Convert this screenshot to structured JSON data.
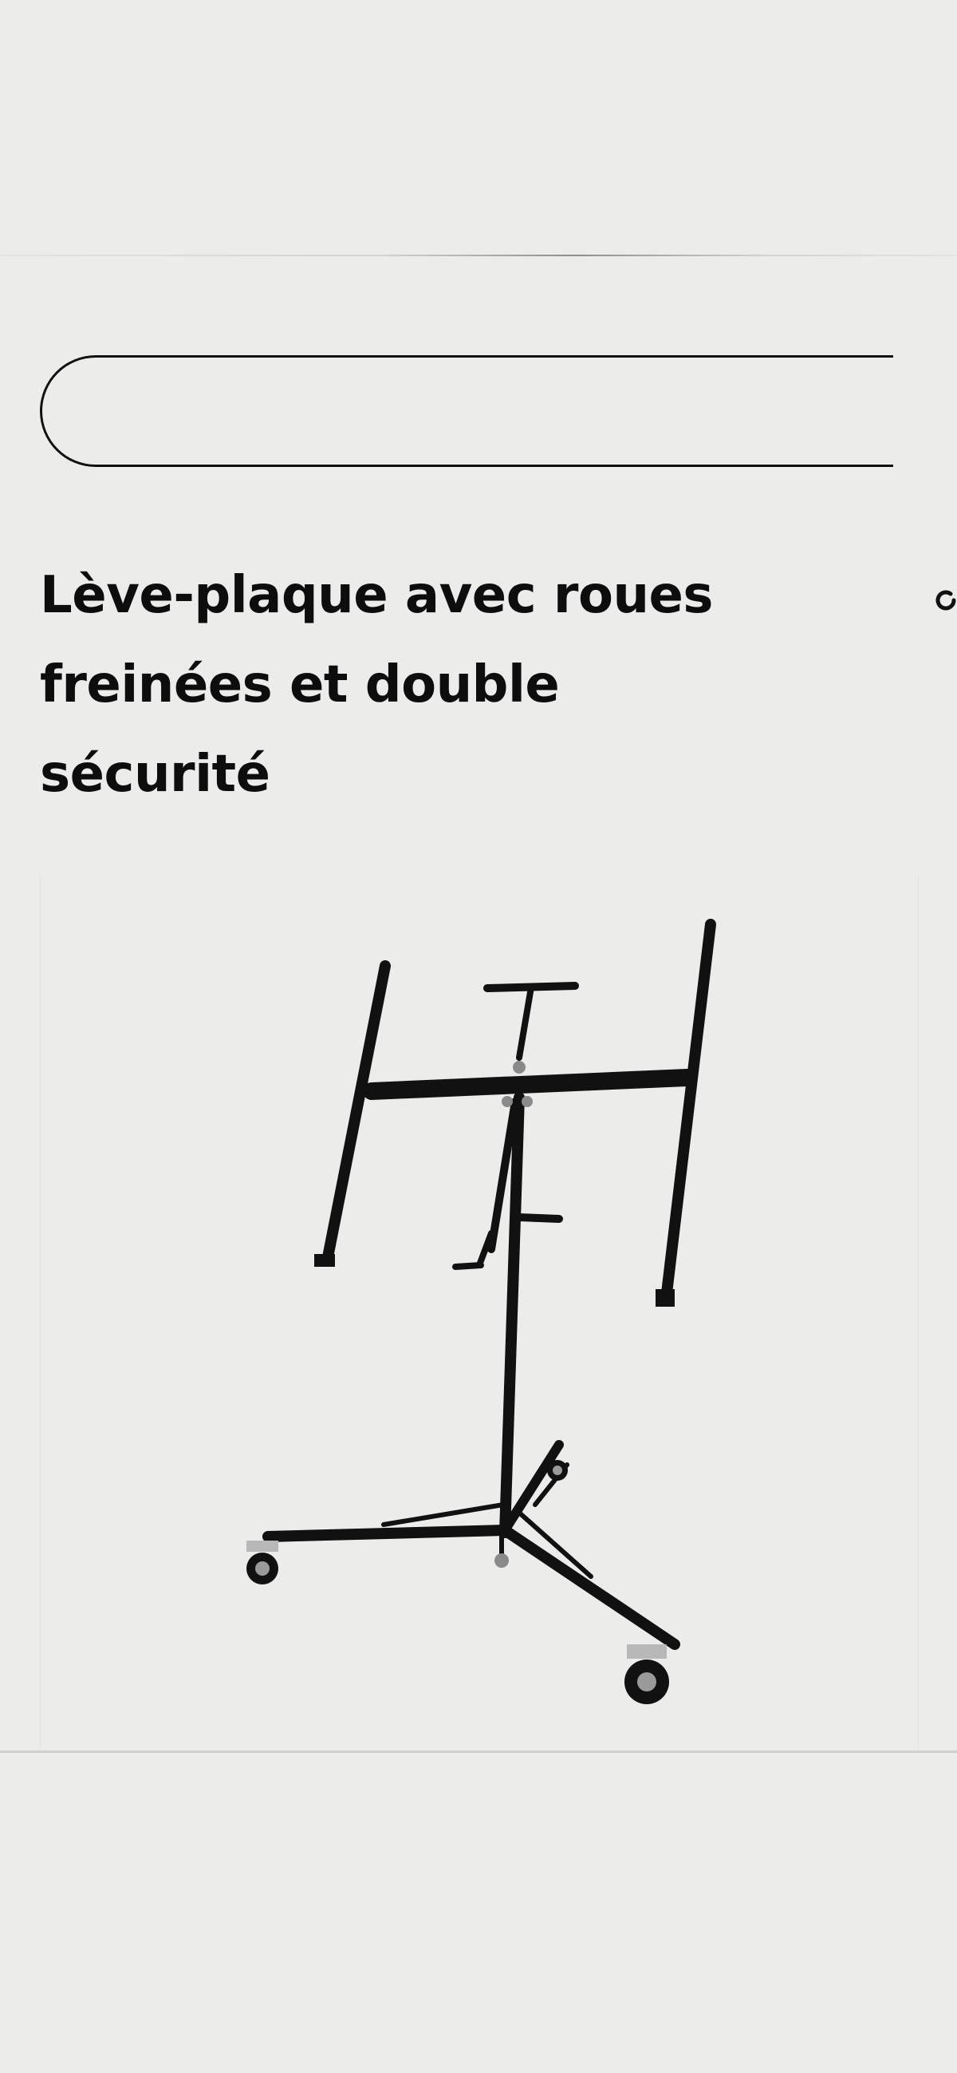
{
  "header": {
    "banner": ""
  },
  "search": {
    "value": "",
    "placeholder": ""
  },
  "product": {
    "title": "Lève-plaque avec roues freinées et double sécurité",
    "image_alt": "Lève-plaque"
  },
  "colors": {
    "background": "#ececeb",
    "text": "#0d0d0d",
    "frame": "#111111"
  },
  "icons": {
    "side_glyph": "loading-spinner-icon"
  }
}
